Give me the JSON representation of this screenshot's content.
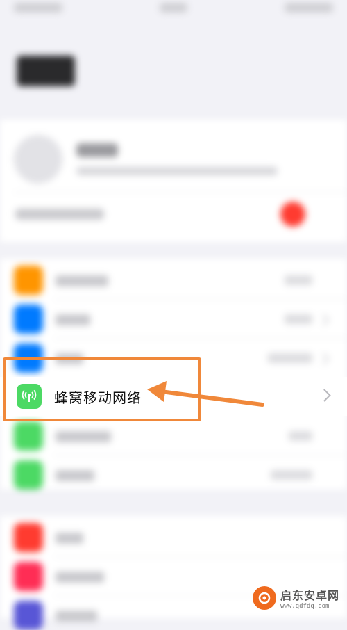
{
  "cellular_row": {
    "label": "蜂窝移动网络",
    "icon": "antenna-signal-icon"
  },
  "annotation": {
    "color": "#f0883a"
  },
  "watermark": {
    "title": "启东安卓网",
    "url": "www.qdfdq.com"
  }
}
